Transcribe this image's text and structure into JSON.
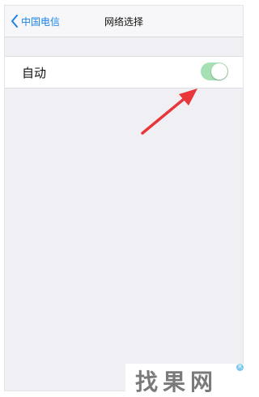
{
  "navbar": {
    "back_label": "中国电信",
    "title": "网络选择"
  },
  "settings": {
    "auto_label": "自动",
    "auto_enabled": true
  },
  "colors": {
    "accent": "#1a84e8",
    "toggle_on": "#a6e0b3",
    "background": "#efeff4",
    "arrow": "#e8363a"
  },
  "watermark": {
    "text": "找果网",
    "reg_mark": "R"
  }
}
